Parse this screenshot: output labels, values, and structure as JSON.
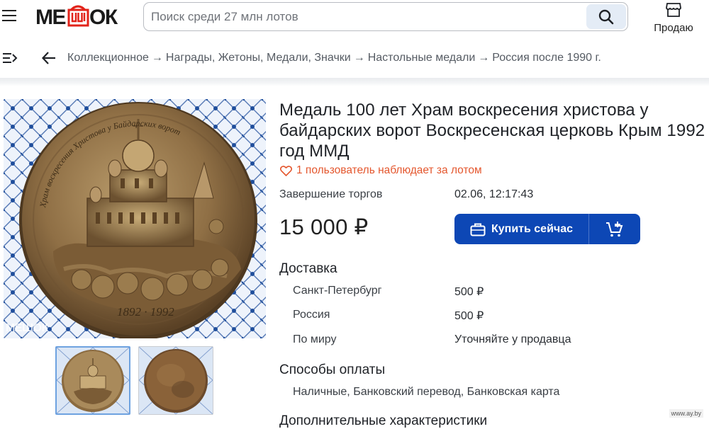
{
  "header": {
    "logo_text": "МЕШОК",
    "search_placeholder": "Поиск среди 27 млн лотов",
    "sell_label": "Продаю"
  },
  "breadcrumbs": [
    "Коллекционное",
    "Награды, Жетоны, Медали, Значки",
    "Настольные медали",
    "Россия после 1990 г."
  ],
  "breadcrumb_separator": "→",
  "gallery": {
    "watermark": "МЕШОК",
    "medal_inscription_years": "1892 · 1992",
    "medal_inscription_top": "Храм воскресения Христова у Байдарских ворот",
    "thumbnails": 2,
    "selected_thumbnail": 1
  },
  "lot": {
    "title": "Медаль 100 лет Храм воскресения христова у байдарских ворот Воскресенская церковь Крым 1992 год ММД",
    "watchers": "1 пользователь наблюдает за лотом",
    "end_label": "Завершение торгов",
    "end_value": "02.06, 12:17:43",
    "price": "15 000 ₽",
    "buy_label": "Купить сейчас"
  },
  "delivery": {
    "heading": "Доставка",
    "rows": [
      {
        "region": "Санкт-Петербург",
        "cost": "500 ₽"
      },
      {
        "region": "Россия",
        "cost": "500 ₽"
      },
      {
        "region": "По миру",
        "cost": "Уточняйте у продавца"
      }
    ]
  },
  "payment": {
    "heading": "Способы оплаты",
    "methods": "Наличные, Банковский перевод, Банковская карта"
  },
  "more": {
    "heading": "Дополнительные характеристики"
  },
  "site_mark": "www.ay.by",
  "colors": {
    "accent": "#0d47b5",
    "watch": "#e4572e",
    "logo_red": "#e2231a"
  }
}
